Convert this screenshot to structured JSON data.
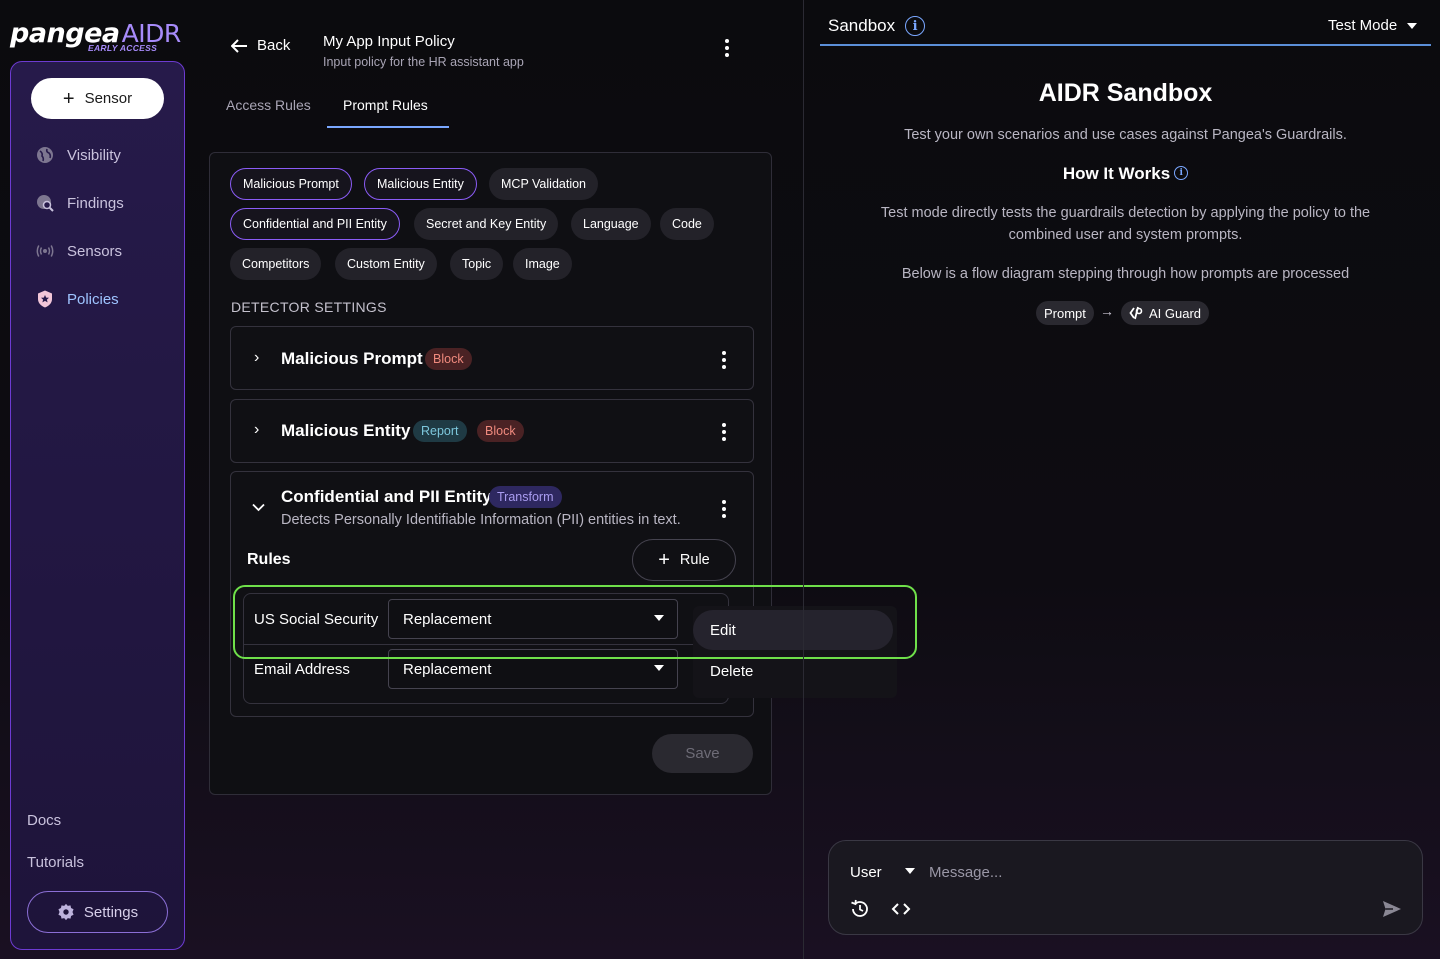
{
  "logo": {
    "brand": "pangea",
    "product": "AIDR",
    "tag": "EARLY ACCESS"
  },
  "sidebar": {
    "sensor_button": "Sensor",
    "items": [
      {
        "label": "Visibility",
        "icon": "globe-icon"
      },
      {
        "label": "Findings",
        "icon": "search-globe-icon"
      },
      {
        "label": "Sensors",
        "icon": "broadcast-icon"
      },
      {
        "label": "Policies",
        "icon": "shield-icon"
      }
    ],
    "docs": "Docs",
    "tutorials": "Tutorials",
    "settings": "Settings"
  },
  "header": {
    "back": "Back",
    "title": "My App Input Policy",
    "subtitle": "Input policy for the HR assistant app"
  },
  "tabs": [
    {
      "label": "Access Rules",
      "active": false
    },
    {
      "label": "Prompt Rules",
      "active": true
    }
  ],
  "chips": [
    {
      "label": "Malicious Prompt",
      "selected": true
    },
    {
      "label": "Malicious Entity",
      "selected": true
    },
    {
      "label": "MCP Validation",
      "selected": false
    },
    {
      "label": "Confidential and PII Entity",
      "selected": true
    },
    {
      "label": "Secret and Key Entity",
      "selected": false
    },
    {
      "label": "Language",
      "selected": false
    },
    {
      "label": "Code",
      "selected": false
    },
    {
      "label": "Competitors",
      "selected": false
    },
    {
      "label": "Custom Entity",
      "selected": false
    },
    {
      "label": "Topic",
      "selected": false
    },
    {
      "label": "Image",
      "selected": false
    }
  ],
  "detector_settings_label": "DETECTOR SETTINGS",
  "detectors": [
    {
      "title": "Malicious Prompt",
      "badges": [
        "Block"
      ]
    },
    {
      "title": "Malicious Entity",
      "badges": [
        "Report",
        "Block"
      ]
    },
    {
      "title": "Confidential and PII Entity",
      "badges": [
        "Transform"
      ],
      "description": "Detects Personally Identifiable Information (PII) entities in text."
    }
  ],
  "rules": {
    "label": "Rules",
    "add_button": "Rule",
    "rows": [
      {
        "name": "US Social Security",
        "method": "Replacement"
      },
      {
        "name": "Email Address",
        "method": "Replacement"
      }
    ]
  },
  "context_menu": {
    "edit": "Edit",
    "delete": "Delete"
  },
  "save": "Save",
  "sandbox": {
    "tab": "Sandbox",
    "mode": "Test Mode",
    "title": "AIDR Sandbox",
    "intro": "Test your own scenarios and use cases against Pangea's Guardrails.",
    "how_it_works": "How It Works",
    "test_mode_desc": "Test mode directly tests the guardrails detection by applying the policy to the combined user and system prompts.",
    "flow_desc": "Below is a flow diagram stepping through how prompts are processed",
    "flow": [
      "Prompt",
      "AI Guard"
    ],
    "role": "User",
    "message_placeholder": "Message..."
  },
  "colors": {
    "accent_purple": "#8b5cf6",
    "link_blue": "#7aa7ff",
    "highlight_green": "#6fe04a",
    "block_badge": "#f08a7e",
    "report_badge": "#7dc7dc",
    "transform_badge": "#a99cf0"
  }
}
